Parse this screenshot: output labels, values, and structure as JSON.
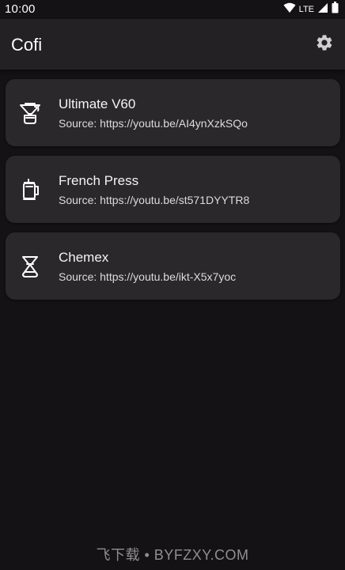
{
  "status_bar": {
    "time": "10:00",
    "network": "LTE",
    "icons": [
      "wifi-icon",
      "cellular-signal-icon",
      "battery-icon"
    ]
  },
  "app_bar": {
    "title": "Cofi",
    "settings_icon": "gear-icon"
  },
  "recipes": [
    {
      "title": "Ultimate V60",
      "subtitle": "Source: https://youtu.be/AI4ynXzkSQo",
      "icon": "v60-dripper-icon"
    },
    {
      "title": "French Press",
      "subtitle": "Source: https://youtu.be/st571DYYTR8",
      "icon": "french-press-icon"
    },
    {
      "title": "Chemex",
      "subtitle": "Source: https://youtu.be/ikt-X5x7yoc",
      "icon": "chemex-icon"
    }
  ],
  "watermark": "飞下载 • BYFZXY.COM",
  "colors": {
    "background": "#141214",
    "app_bar": "#232123",
    "card": "#2a282a",
    "text_primary": "#f4f4f4",
    "text_secondary": "#dcdcdc"
  }
}
